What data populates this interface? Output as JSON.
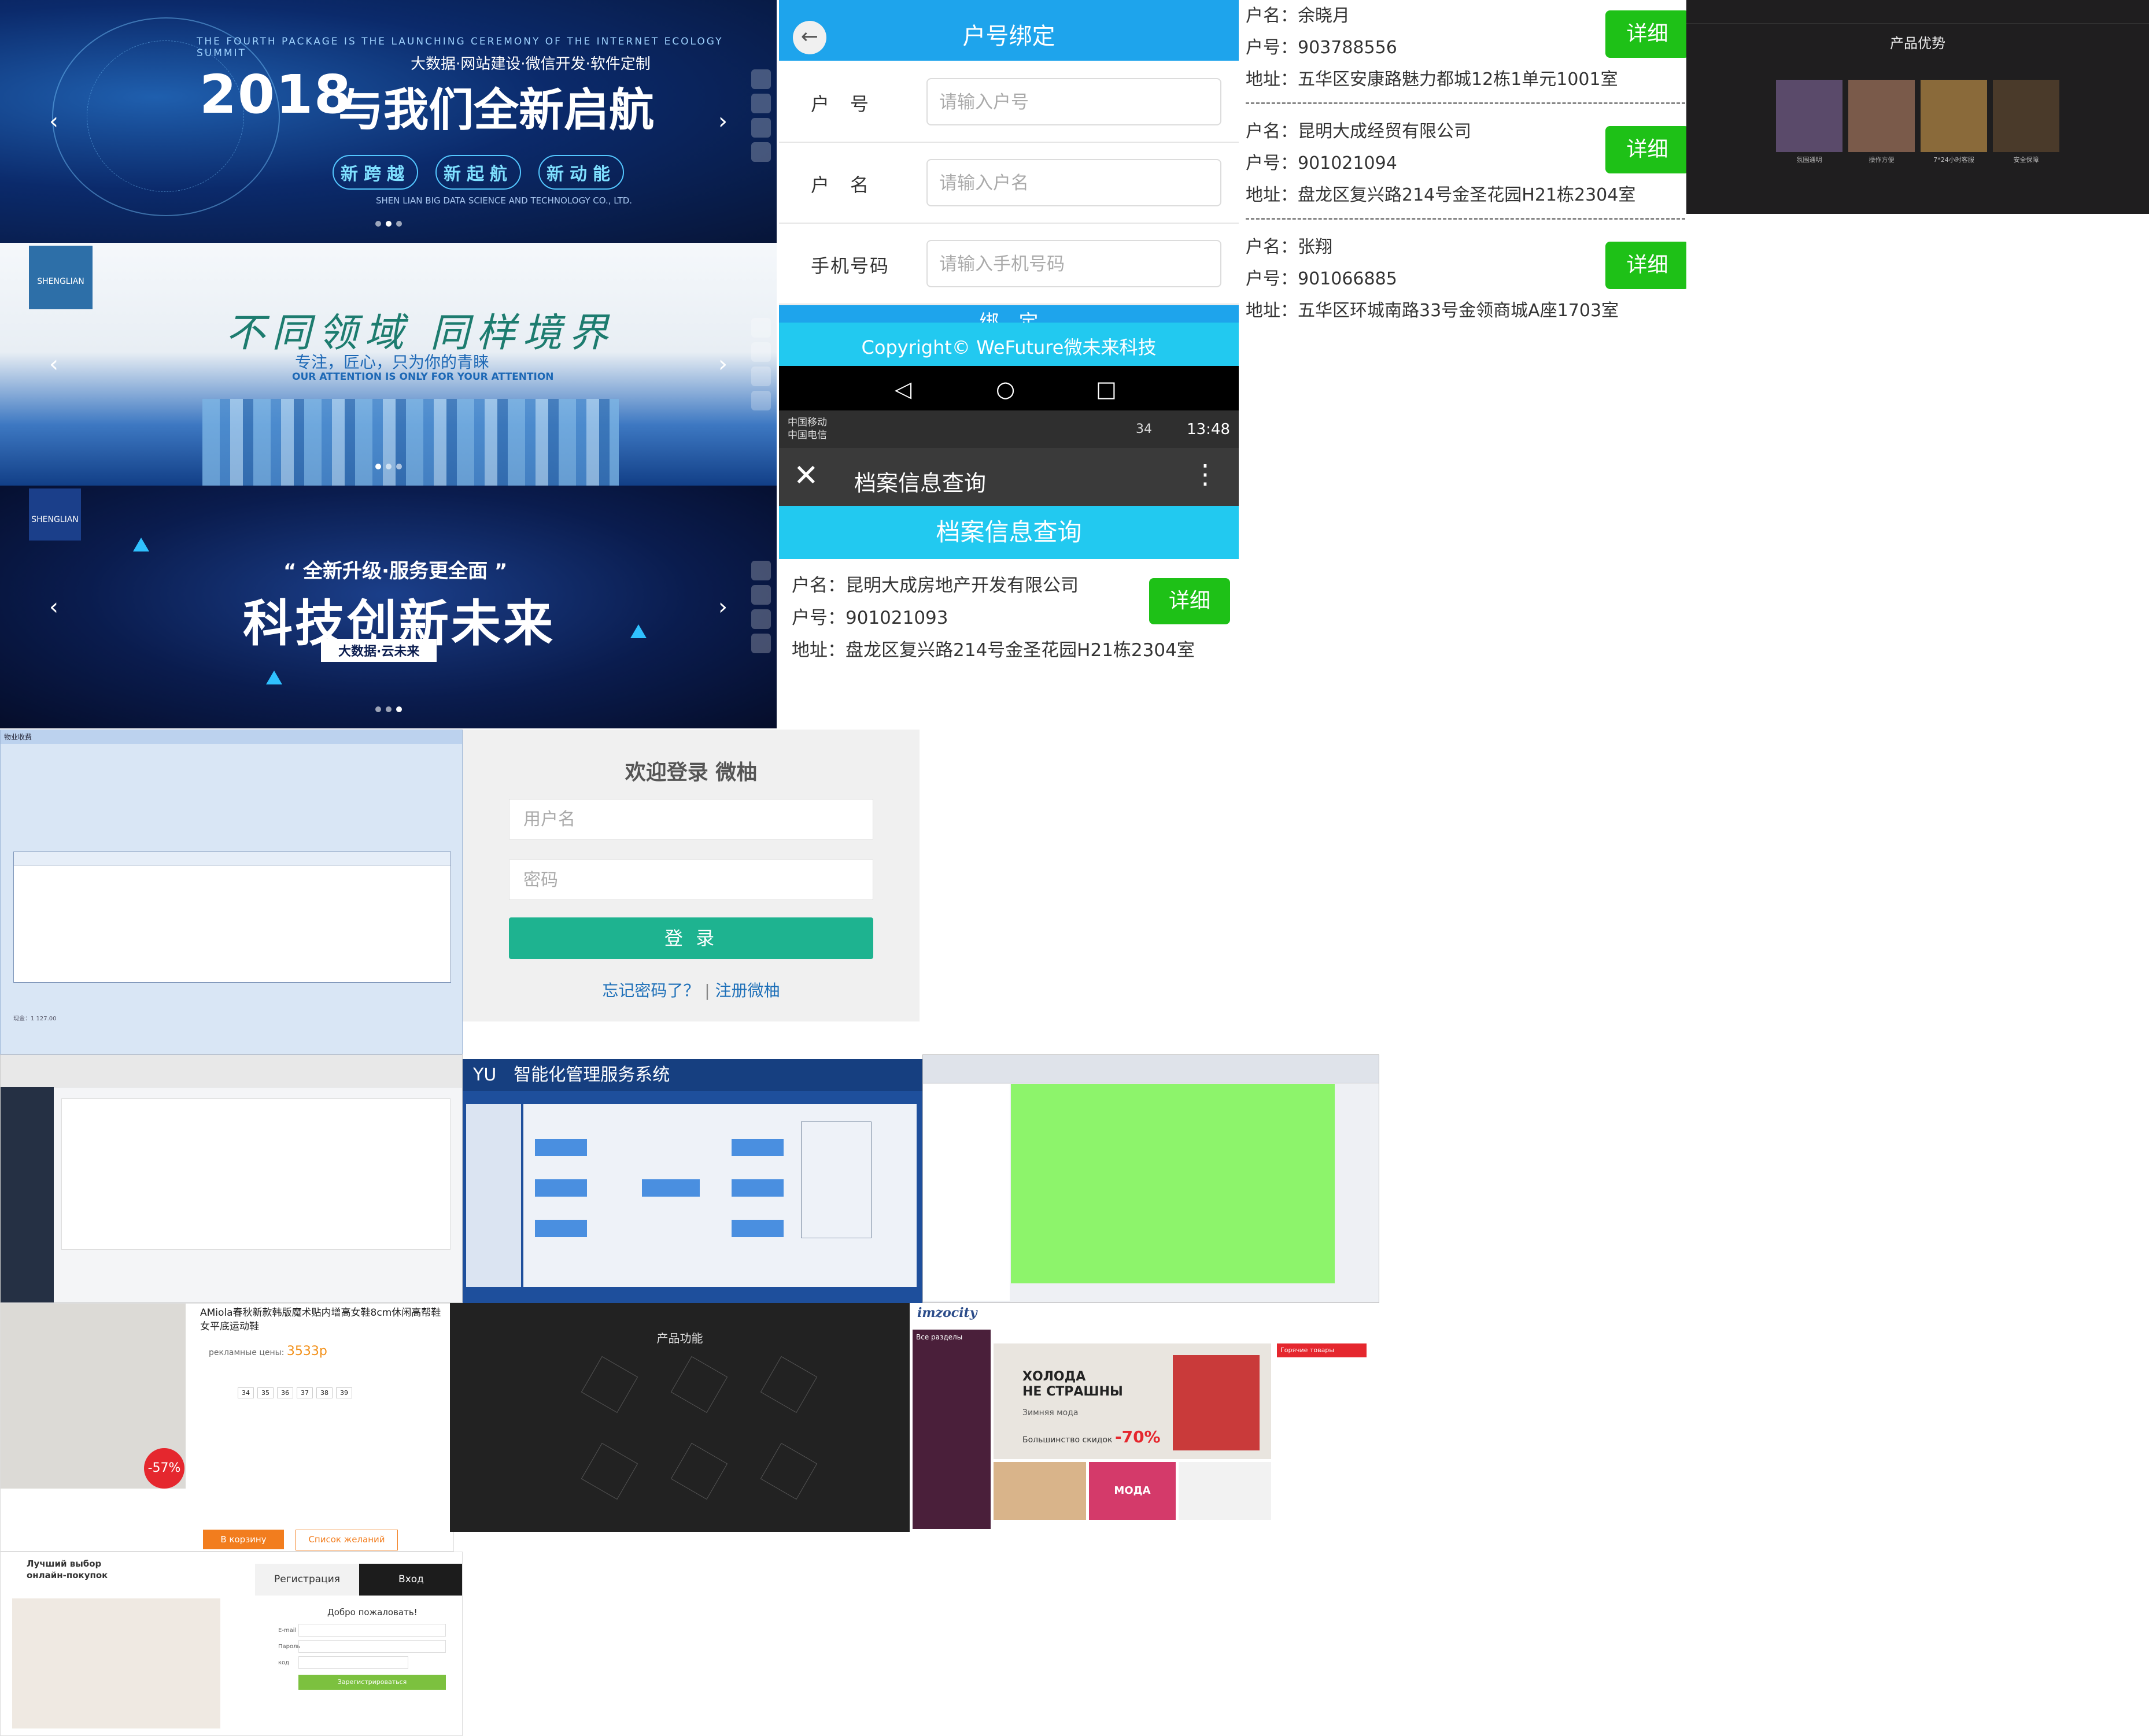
{
  "banner1": {
    "tagline": "THE FOURTH PACKAGE IS THE LAUNCHING CEREMONY OF THE INTERNET ECOLOGY SUMMIT",
    "year": "2018",
    "subtitle": "大数据·网站建设·微信开发·软件定制",
    "main_title": "与我们全新启航",
    "pills": [
      "新跨越",
      "新起航",
      "新动能"
    ],
    "company_en": "SHEN LIAN BIG DATA SCIENCE AND TECHNOLOGY CO., LTD."
  },
  "banner2": {
    "logo_text": "SHENGLIAN",
    "title": "不同领域 同样境界",
    "subtitle": "专注，匠心，只为你的青睐",
    "subtitle_en": "OUR ATTENTION IS ONLY FOR YOUR ATTENTION"
  },
  "banner3": {
    "logo_text": "SHENGLIAN",
    "quote": "“ 全新升级·服务更全面 ”",
    "main_title": "科技创新未来",
    "subtitle": "大数据·云未来"
  },
  "phone_bind": {
    "title": "户号绑定",
    "fields": [
      {
        "label": "户　号",
        "placeholder": "请输入户号"
      },
      {
        "label": "户　名",
        "placeholder": "请输入户名"
      },
      {
        "label": "手机号码",
        "placeholder": "请输入手机号码"
      }
    ],
    "bind_button": "绑　定",
    "copyright": "Copyright© WeFuture微未来科技"
  },
  "phone_query": {
    "carrier1": "中国移动",
    "carrier2": "中国电信",
    "time": "13:48",
    "battery": "34",
    "window_title": "档案信息查询",
    "page_title": "档案信息查询",
    "record": {
      "name_label": "户名：",
      "name": "昆明大成房地产开发有限公司",
      "id_label": "户号：",
      "id": "901021093",
      "addr_label": "地址：",
      "addr": "盘龙区复兴路214号金圣花园H21栋2304室"
    },
    "detail_button": "详细"
  },
  "record_list": {
    "detail_button": "详细",
    "items": [
      {
        "name": "户名：余晓月",
        "id": "户号：903788556",
        "addr": "地址：五华区安康路魅力都城12栋1单元1001室"
      },
      {
        "name": "户名：昆明大成经贸有限公司",
        "id": "户号：901021094",
        "addr": "地址：盘龙区复兴路214号金圣花园H21栋2304室"
      },
      {
        "name": "户名：张翔",
        "id": "户号：901066885",
        "addr": "地址：五华区环城南路33号金领商城A座1703室"
      }
    ]
  },
  "product_dark": {
    "title": "产品优势",
    "captions": [
      "氛围通明",
      "操作方便",
      "7*24小时客服",
      "安全保障"
    ]
  },
  "erp": {
    "window_title": "物业收费",
    "total_label": "现金：",
    "total_value": "1 127.00"
  },
  "login": {
    "title": "欢迎登录 微柚",
    "username_placeholder": "用户名",
    "password_placeholder": "密码",
    "button": "登 录",
    "forgot": "忘记密码了？",
    "register": "注册微柚"
  },
  "nms": {
    "title": "智能化管理服务系统",
    "brand": "YU"
  },
  "shop1": {
    "title": "AMiola春秋新款韩版魔术贴内增高女鞋8cm休闲高帮鞋女平底运动鞋",
    "price_label": "рекламные цены",
    "price": "3533р",
    "discount": "-57%",
    "cart_button": "В корзину",
    "wish_button": "Список желаний",
    "sizes": [
      "34",
      "35",
      "36",
      "37",
      "38",
      "39"
    ]
  },
  "features": {
    "title": "产品功能"
  },
  "imzo": {
    "logo": "imzocity",
    "categories_title": "Все разделы",
    "hero_line1": "ХОЛОДА",
    "hero_line2": "НЕ СТРАШНЫ",
    "hero_sub": "Зимняя мода",
    "discount_text": "Большинство скидок",
    "discount": "-70%",
    "fashion": "МОДА",
    "hot_label": "Горячие товары"
  },
  "register": {
    "promo_line1": "Лучший выбор",
    "promo_line2": "онлайн-покупок",
    "tab_register": "Регистрация",
    "tab_login": "Вход",
    "welcome": "Добро пожаловать!",
    "email_label": "E-mail",
    "password_label": "Пароль",
    "code_label": "код",
    "submit": "Зарегистрироваться"
  }
}
